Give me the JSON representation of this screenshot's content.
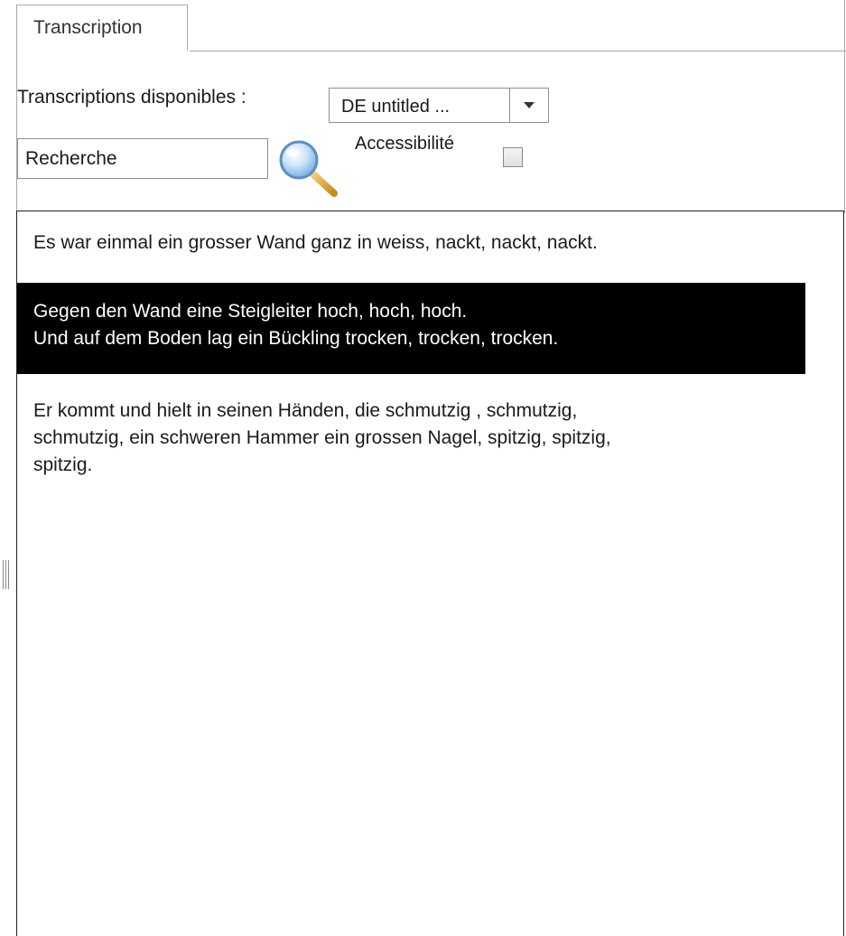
{
  "tab": {
    "label": "Transcription"
  },
  "transcriptions": {
    "label": "Transcriptions disponibles :",
    "selected": "DE untitled ..."
  },
  "search": {
    "placeholder": "Recherche"
  },
  "accessibility": {
    "label": "Accessibilité",
    "checked": false
  },
  "transcript": {
    "segments": [
      {
        "lines": [
          "Es war einmal ein grosser Wand ganz in weiss, nackt, nackt, nackt."
        ],
        "active": false
      },
      {
        "lines": [
          "Gegen den Wand eine Steigleiter hoch, hoch, hoch.",
          "Und auf dem Boden lag ein Bückling trocken, trocken, trocken."
        ],
        "active": true
      },
      {
        "lines": [
          "Er kommt und hielt in seinen Händen, die schmutzig , schmutzig,",
          "schmutzig, ein schweren Hammer  ein grossen Nagel, spitzig,  spitzig,",
          "spitzig."
        ],
        "active": false
      }
    ]
  },
  "colors": {
    "active_segment_background": "#000000",
    "active_segment_text": "#ffffff",
    "border": "#a8a8a8"
  },
  "icons": {
    "search": "magnifier-icon",
    "splitter": "grip-handle-icon",
    "dropdown": "chevron-down-icon"
  }
}
